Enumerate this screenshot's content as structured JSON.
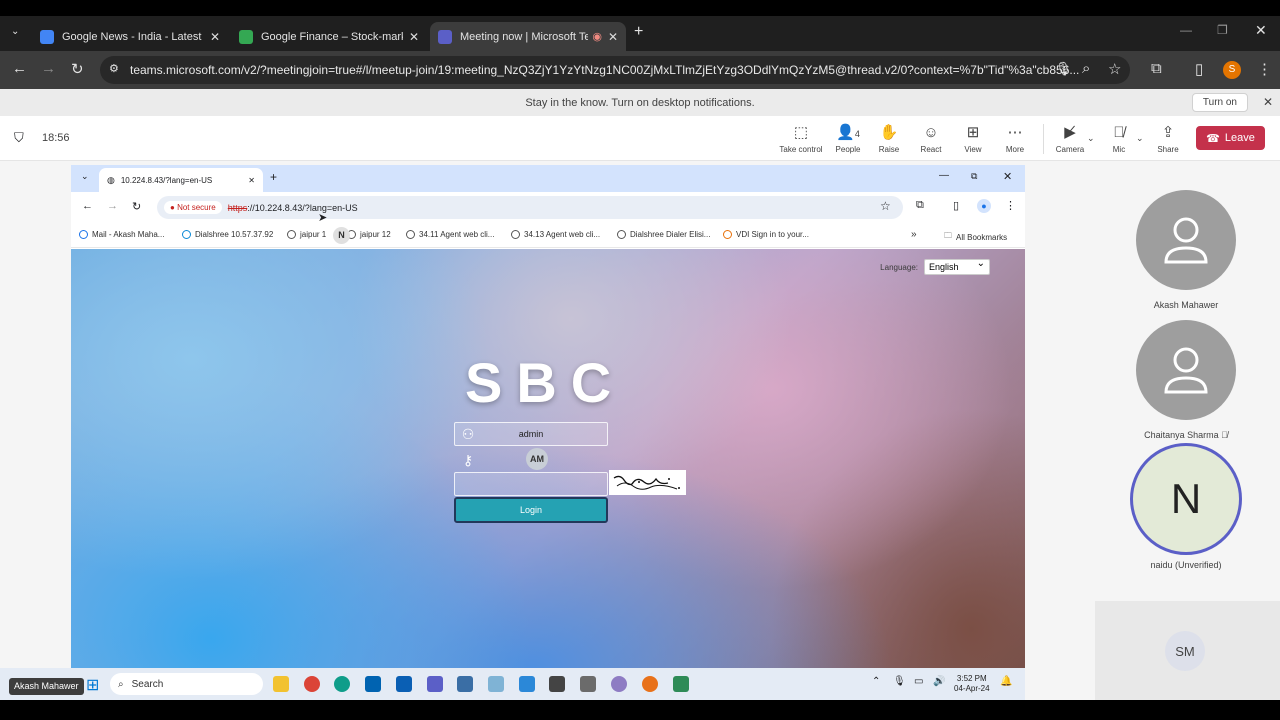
{
  "outer_tabs": [
    {
      "title": "Google News - India - Latest",
      "color": "#4285f4",
      "active": false
    },
    {
      "title": "Google Finance – Stock-market",
      "color": "#34a853",
      "active": false
    },
    {
      "title": "Meeting now | Microsoft Te",
      "color": "#5b5fc7",
      "active": true
    }
  ],
  "outer_url": "teams.microsoft.com/v2/?meetingjoin=true#/l/meetup-join/19:meeting_NzQ3ZjY1YzYtNzg1NC00ZjMxLTlmZjEtYzg3ODdlYmQzYzM5@thread.v2/0?context=%7b\"Tid\"%3a\"cb856...",
  "notification": {
    "text": "Stay in the know. Turn on desktop notifications.",
    "button": "Turn on"
  },
  "teams": {
    "time": "18:56",
    "controls": [
      {
        "label": "Take control",
        "icon": "take-control-icon"
      },
      {
        "label": "People",
        "icon": "people-icon",
        "count": "4"
      },
      {
        "label": "Raise",
        "icon": "raise-hand-icon"
      },
      {
        "label": "React",
        "icon": "react-icon"
      },
      {
        "label": "View",
        "icon": "view-icon"
      },
      {
        "label": "More",
        "icon": "more-icon"
      },
      {
        "label": "Camera",
        "icon": "camera-off-icon"
      },
      {
        "label": "Mic",
        "icon": "mic-off-icon"
      },
      {
        "label": "Share",
        "icon": "share-icon"
      }
    ],
    "leave": "Leave",
    "leave_color": "#c4314b"
  },
  "inner_browser": {
    "tab_title": "10.224.8.43/?lang=en-US",
    "not_secure": "Not secure",
    "url_scheme": "https",
    "url_rest": "://10.224.8.43/?lang=en-US",
    "bookmarks": [
      "Mail - Akash Maha...",
      "Dialshree 10.57.37.92",
      "jaipur 1",
      "jaipur 12",
      "34.11 Agent web cli...",
      "34.13 Agent web cli...",
      "Dialshree Dialer Elisi...",
      "VDI Sign in to your..."
    ],
    "all_bookmarks": "All Bookmarks",
    "overlay_badge": "N"
  },
  "login": {
    "language_label": "Language:",
    "language_value": "English",
    "logo": "SBC",
    "username": "admin",
    "password_badge": "AM",
    "captcha_value": "",
    "button": "Login"
  },
  "participants": [
    {
      "name": "Akash Mahawer",
      "type": "avatar"
    },
    {
      "name": "Chaitanya Sharma",
      "type": "avatar",
      "muted": true
    },
    {
      "name": "naidu (Unverified)",
      "type": "initial",
      "initial": "N"
    },
    {
      "name": "",
      "type": "initials",
      "initial": "SM"
    }
  ],
  "presenter": "Akash Mahawer",
  "taskbar": {
    "search": "Search",
    "time": "3:52 PM",
    "date": "04-Apr-24"
  }
}
